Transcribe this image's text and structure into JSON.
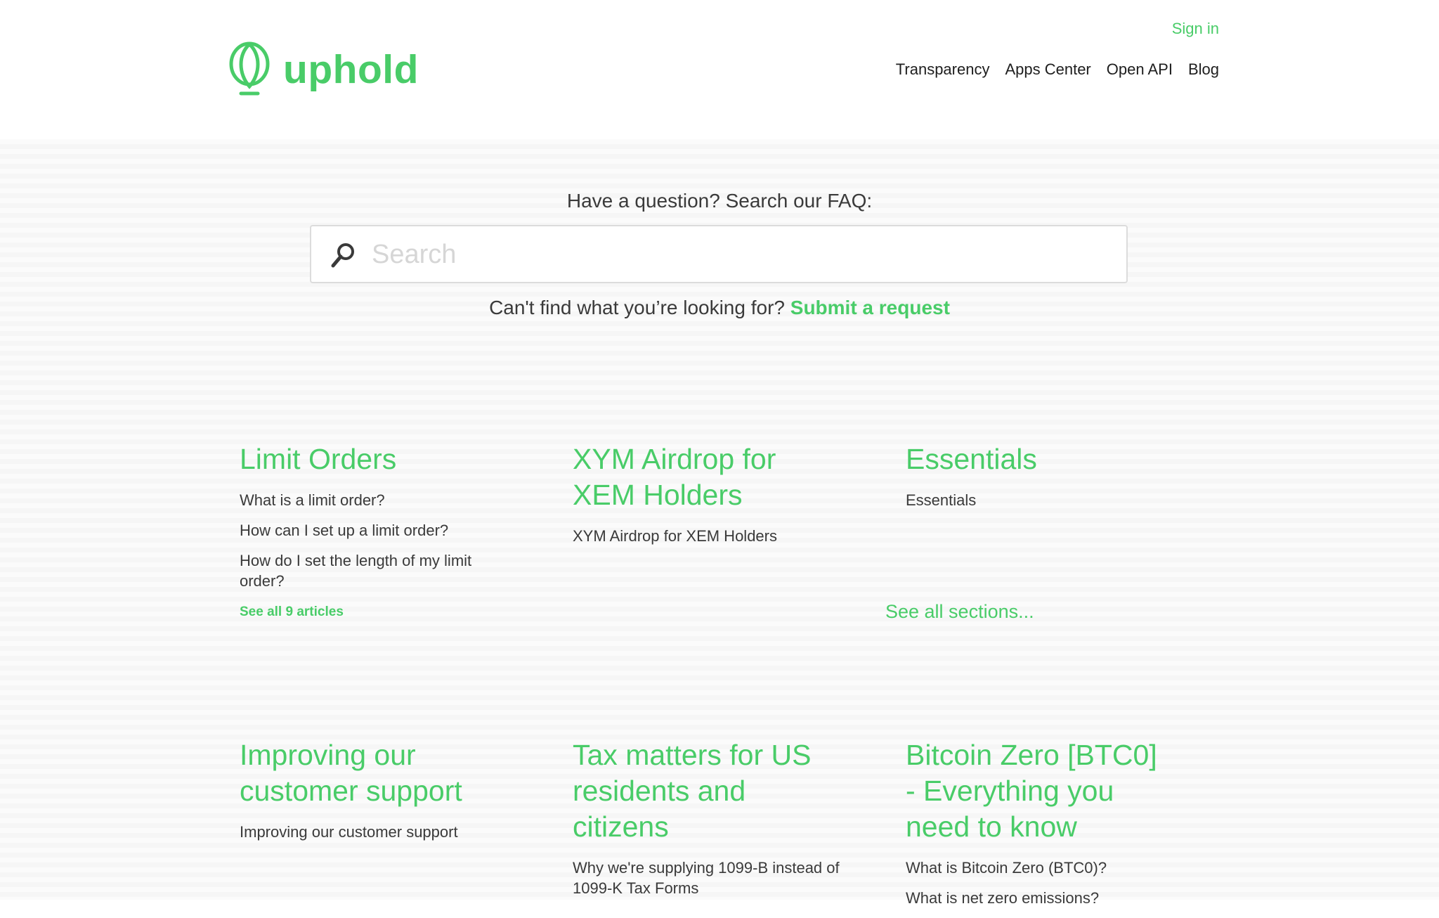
{
  "header": {
    "logo_text": "uphold",
    "sign_in": "Sign in",
    "nav": [
      "Transparency",
      "Apps Center",
      "Open API",
      "Blog"
    ]
  },
  "search": {
    "heading": "Have a question? Search our FAQ:",
    "placeholder": "Search",
    "cant_find_text": "Can't find what you’re looking for?",
    "submit_request": "Submit a request"
  },
  "sections": [
    {
      "title": "Limit Orders",
      "articles": [
        "What is a limit order?",
        "How can I set up a limit order?",
        "How do I set the length of my limit order?"
      ],
      "see_all": "See all 9 articles"
    },
    {
      "title": "XYM Airdrop for XEM Holders",
      "articles": [
        "XYM Airdrop for XEM Holders"
      ]
    },
    {
      "title": "Essentials",
      "articles": [
        "Essentials"
      ]
    },
    {
      "title": "Improving our customer support",
      "articles": [
        "Improving our customer support"
      ]
    },
    {
      "title": "Tax matters for US residents and citizens",
      "articles": [
        "Why we're supplying 1099-B instead of 1099-K Tax Forms"
      ]
    },
    {
      "title": "Bitcoin Zero [BTC0] - Everything you need to know",
      "articles": [
        "What is Bitcoin Zero (BTC0)?",
        "What is net zero emissions?"
      ]
    }
  ],
  "see_all_sections": "See all sections...",
  "colors": {
    "brand_green": "#49cc68",
    "text": "#3a3a3a",
    "background": "#f6f6f6"
  },
  "icons": {
    "logo": "uphold-logo-icon",
    "search": "search-icon"
  }
}
